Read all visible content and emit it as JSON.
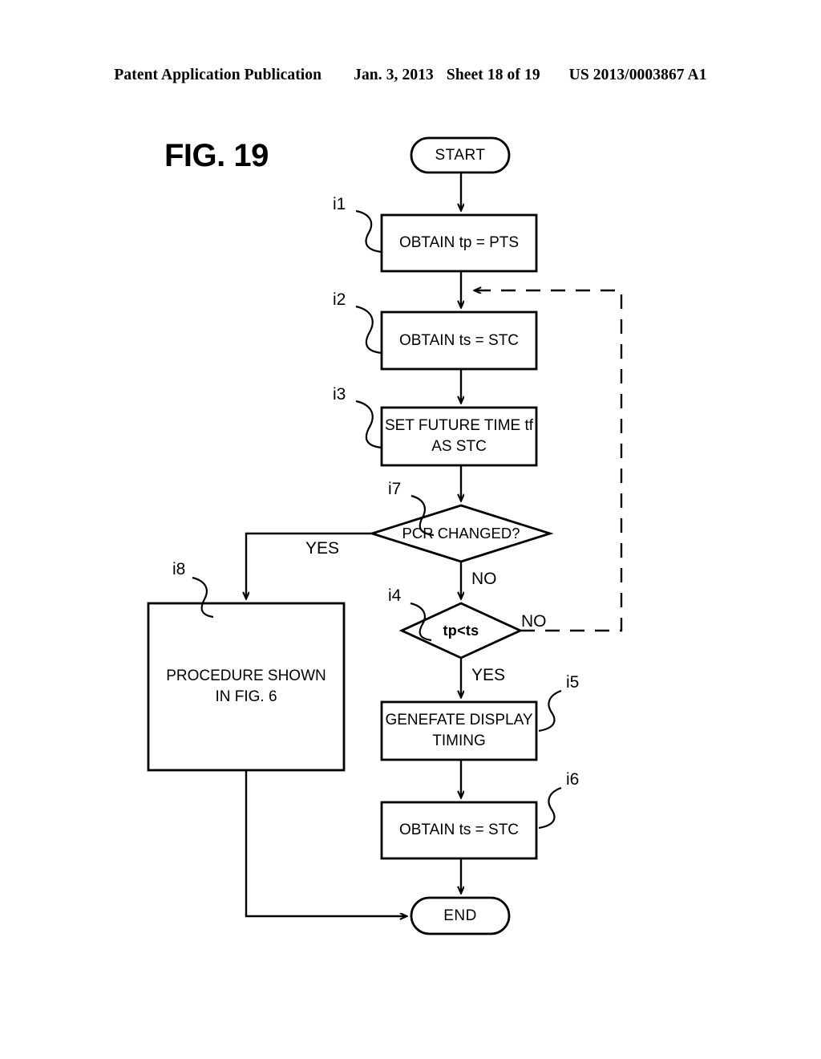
{
  "header": {
    "publication": "Patent Application Publication",
    "date": "Jan. 3, 2013",
    "sheet": "Sheet 18 of 19",
    "number": "US 2013/0003867 A1"
  },
  "figure": {
    "title": "FIG. 19"
  },
  "flowchart": {
    "nodes": {
      "start": {
        "ref": "",
        "text": "START",
        "shape": "terminator"
      },
      "i1": {
        "ref": "i1",
        "text": "OBTAIN tp = PTS",
        "shape": "process"
      },
      "i2": {
        "ref": "i2",
        "text": "OBTAIN ts = STC",
        "shape": "process"
      },
      "i3": {
        "ref": "i3",
        "text": "SET FUTURE TIME tf\nAS STC",
        "shape": "process"
      },
      "i7": {
        "ref": "i7",
        "text": "PCR CHANGED?",
        "shape": "decision"
      },
      "i4": {
        "ref": "i4",
        "text": "tp<ts",
        "shape": "decision"
      },
      "i8": {
        "ref": "i8",
        "text": "PROCEDURE SHOWN\nIN FIG. 6",
        "shape": "process"
      },
      "i5": {
        "ref": "i5",
        "text": "GENEFATE DISPLAY\nTIMING",
        "shape": "process"
      },
      "i6": {
        "ref": "i6",
        "text": "OBTAIN ts = STC",
        "shape": "process"
      },
      "end": {
        "ref": "",
        "text": "END",
        "shape": "terminator"
      }
    },
    "branches": {
      "pcr_yes": "YES",
      "pcr_no": "NO",
      "tpts_no": "NO",
      "tpts_yes": "YES"
    },
    "colors": {
      "stroke": "#000000",
      "fill": "#ffffff"
    }
  }
}
